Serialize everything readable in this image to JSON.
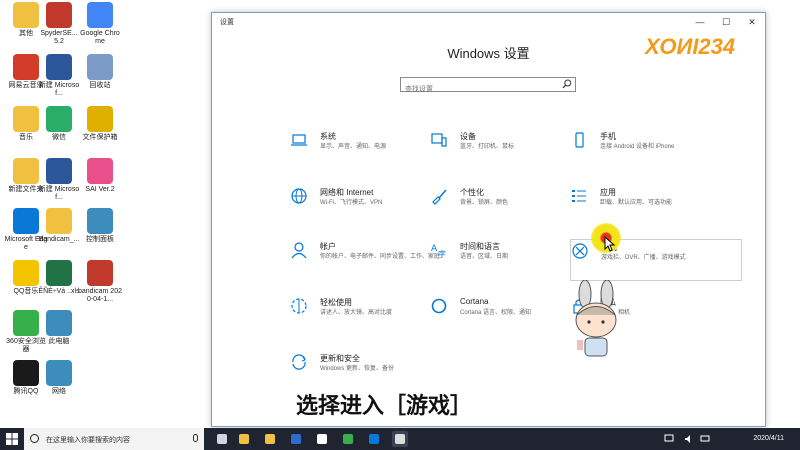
{
  "desktop": {
    "icons": [
      {
        "label": "其他",
        "color": "#f0c040"
      },
      {
        "label": "SpyderSE... 5.2",
        "color": "#c0392b"
      },
      {
        "label": "Google Chrome",
        "color": "#4285f4"
      },
      {
        "label": "网易云音乐",
        "color": "#d23c2a"
      },
      {
        "label": "新建 Microsof...",
        "color": "#2b579a"
      },
      {
        "label": "回收站",
        "color": "#7a9cc6"
      },
      {
        "label": "音乐",
        "color": "#f0c040"
      },
      {
        "label": "微信",
        "color": "#2aae67"
      },
      {
        "label": "文件保护箱",
        "color": "#e0b000"
      },
      {
        "label": "新建文件夹",
        "color": "#f0c040"
      },
      {
        "label": "新建 Microsof...",
        "color": "#2b579a"
      },
      {
        "label": "SAI Ver.2",
        "color": "#e94f8a"
      },
      {
        "label": "Microsoft Edge",
        "color": "#0a78d7"
      },
      {
        "label": "Bandicam_...",
        "color": "#f0c040"
      },
      {
        "label": "控制面板",
        "color": "#3c8dbc"
      },
      {
        "label": "QQ音乐",
        "color": "#f5c400"
      },
      {
        "label": "ÊÑÉ÷Vá ..xls",
        "color": "#217346"
      },
      {
        "label": "bandicam 2020-04-1...",
        "color": "#c0392b"
      },
      {
        "label": "360安全浏览器",
        "color": "#36b04a"
      },
      {
        "label": "此电脑",
        "color": "#3c8dbc"
      },
      {
        "label": "腾讯QQ",
        "color": "#1a1a1a"
      },
      {
        "label": "网络",
        "color": "#3c8dbc"
      }
    ]
  },
  "window": {
    "title": "设置",
    "controls": {
      "minimize": "—",
      "maximize": "☐",
      "close": "✕"
    },
    "hero_title": "Windows 设置",
    "search_placeholder": "查找设置"
  },
  "categories": [
    {
      "title": "系统",
      "desc": "显示、声音、通知、电源",
      "icon": "laptop-icon"
    },
    {
      "title": "设备",
      "desc": "蓝牙、打印机、鼠标",
      "icon": "devices-icon"
    },
    {
      "title": "手机",
      "desc": "连接 Android 设备和 iPhone",
      "icon": "phone-icon"
    },
    {
      "title": "网络和 Internet",
      "desc": "Wi-Fi、飞行模式、VPN",
      "icon": "globe-icon"
    },
    {
      "title": "个性化",
      "desc": "背景、锁屏、颜色",
      "icon": "paintbrush-icon"
    },
    {
      "title": "应用",
      "desc": "卸载、默认应用、可选功能",
      "icon": "apps-list-icon"
    },
    {
      "title": "帐户",
      "desc": "你的帐户、电子邮件、同步设置、工作、家庭",
      "icon": "person-icon"
    },
    {
      "title": "时间和语言",
      "desc": "语音、区域、日期",
      "icon": "time-language-icon"
    },
    {
      "title": "游戏",
      "desc": "游戏栏、DVR、广播、游戏模式",
      "icon": "xbox-icon"
    },
    {
      "title": "轻松使用",
      "desc": "讲述人、放大镜、高对比度",
      "icon": "ease-of-access-icon"
    },
    {
      "title": "Cortana",
      "desc": "Cortana 语言、权限、通知",
      "icon": "cortana-icon"
    },
    {
      "title": "隐私",
      "desc": "位置、相机",
      "icon": "lock-icon"
    },
    {
      "title": "更新和安全",
      "desc": "Windows 更新、恢复、备份",
      "icon": "update-icon"
    }
  ],
  "overlay": {
    "watermark": "ХОИІ234",
    "caption": "选择进入［游戏］"
  },
  "taskbar": {
    "search_placeholder": "在这里输入你要搜索的内容",
    "date": "2020/4/11",
    "apps": [
      {
        "name": "task-view",
        "color": "#cfd5e0"
      },
      {
        "name": "store",
        "color": "#f0c040"
      },
      {
        "name": "file-explorer",
        "color": "#f0c040"
      },
      {
        "name": "mail",
        "color": "#2b6cd0"
      },
      {
        "name": "tencent-qq",
        "color": "#ffffff"
      },
      {
        "name": "360-browser",
        "color": "#36b04a"
      },
      {
        "name": "edge",
        "color": "#0a78d7"
      },
      {
        "name": "settings",
        "color": "#dddddd"
      }
    ]
  },
  "colors": {
    "accent": "#0078d7",
    "taskbar": "#1f2430",
    "watermark": "#f29a1a"
  }
}
